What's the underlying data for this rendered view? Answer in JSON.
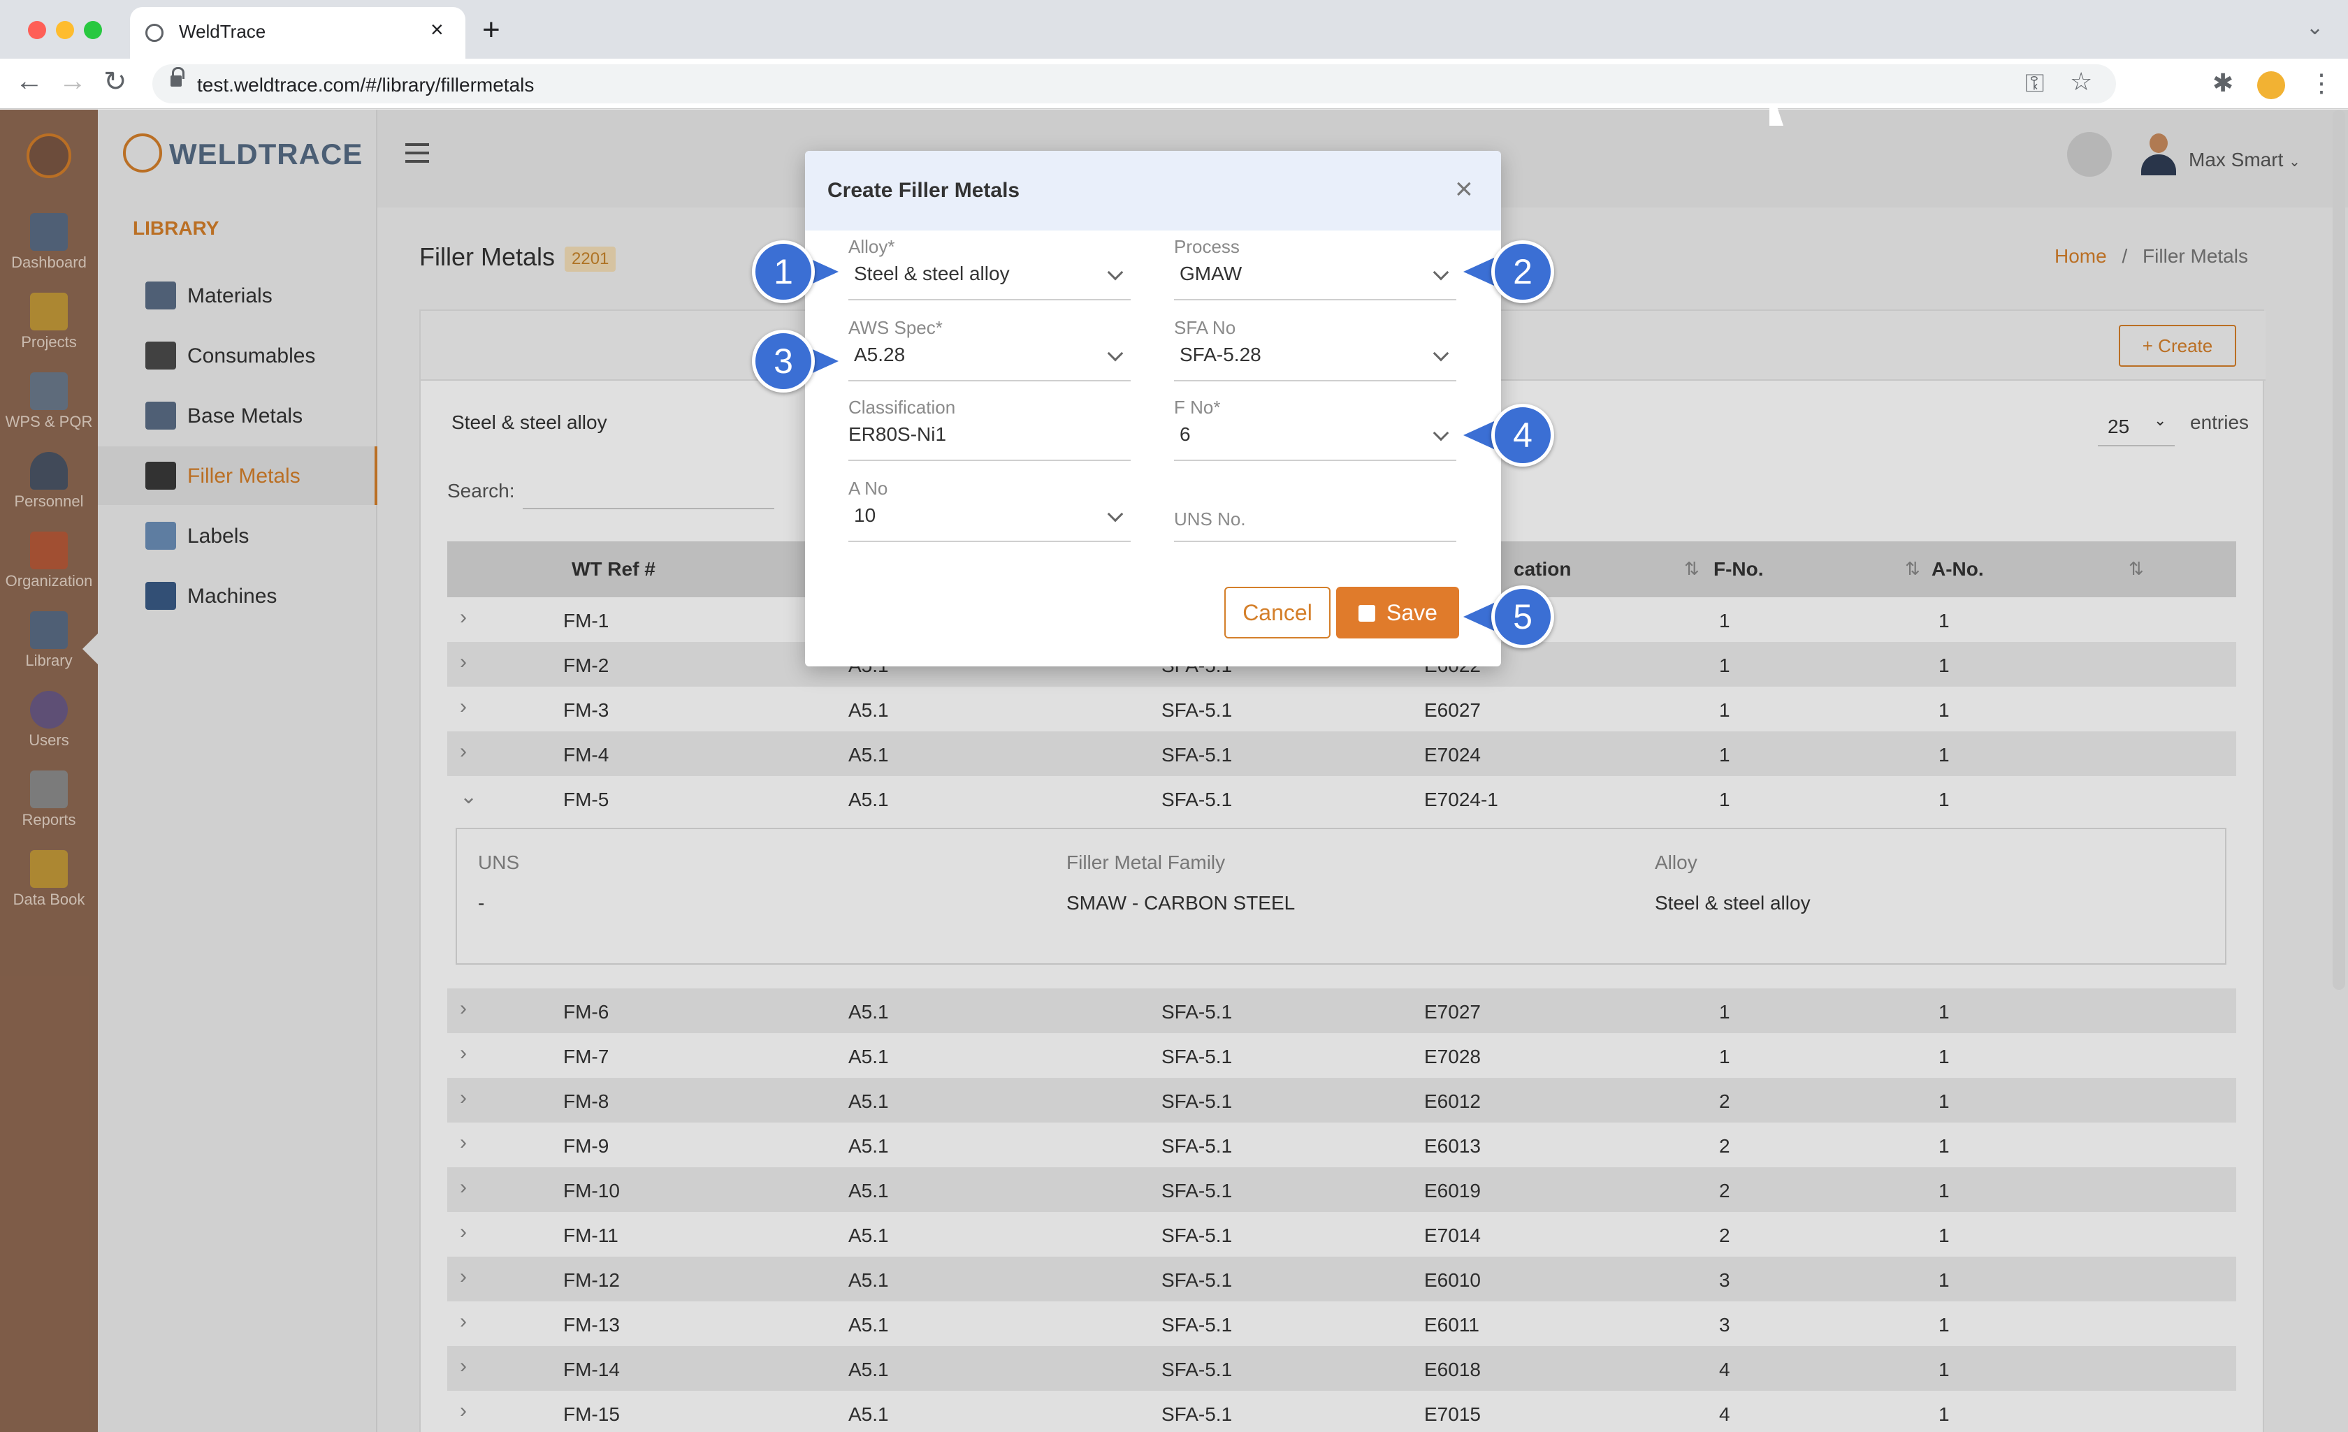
{
  "browser": {
    "tab_title": "WeldTrace",
    "url": "test.weldtrace.com/#/library/fillermetals"
  },
  "app_nav": [
    {
      "label": "Dashboard",
      "icon": "monitor-icon"
    },
    {
      "label": "Projects",
      "icon": "folder-icon"
    },
    {
      "label": "WPS & PQR",
      "icon": "document-gear-icon"
    },
    {
      "label": "Personnel",
      "icon": "welder-icon"
    },
    {
      "label": "Organization",
      "icon": "organization-icon"
    },
    {
      "label": "Library",
      "icon": "library-icon"
    },
    {
      "label": "Users",
      "icon": "users-icon"
    },
    {
      "label": "Reports",
      "icon": "report-icon"
    },
    {
      "label": "Data Book",
      "icon": "data-book-icon"
    }
  ],
  "logo_text": "WELDTRACE",
  "sidebar": {
    "heading": "LIBRARY",
    "items": [
      {
        "label": "Materials",
        "icon": "materials-icon"
      },
      {
        "label": "Consumables",
        "icon": "consumables-icon"
      },
      {
        "label": "Base Metals",
        "icon": "base-metals-icon"
      },
      {
        "label": "Filler Metals",
        "icon": "filler-metals-icon"
      },
      {
        "label": "Labels",
        "icon": "labels-icon"
      },
      {
        "label": "Machines",
        "icon": "machines-icon"
      }
    ]
  },
  "header": {
    "user_name": "Max Smart"
  },
  "page": {
    "title": "Filler Metals",
    "count": "2201",
    "breadcrumb_home": "Home",
    "breadcrumb_sep": "/",
    "breadcrumb_current": "Filler Metals"
  },
  "toolbar": {
    "create_label": "+ Create",
    "alloy_filter": "Steel & steel alloy",
    "entries_value": "25",
    "entries_label": "entries",
    "search_label": "Search:"
  },
  "table": {
    "headers": [
      "WT Ref #",
      "cation",
      "F-No.",
      "A-No."
    ],
    "rows": [
      {
        "ref": "FM-1",
        "aws": "",
        "sfa": "",
        "cls": "",
        "fno": "1",
        "ano": "1"
      },
      {
        "ref": "FM-2",
        "aws": "A5.1",
        "sfa": "SFA-5.1",
        "cls": "E6022",
        "fno": "1",
        "ano": "1"
      },
      {
        "ref": "FM-3",
        "aws": "A5.1",
        "sfa": "SFA-5.1",
        "cls": "E6027",
        "fno": "1",
        "ano": "1"
      },
      {
        "ref": "FM-4",
        "aws": "A5.1",
        "sfa": "SFA-5.1",
        "cls": "E7024",
        "fno": "1",
        "ano": "1"
      },
      {
        "ref": "FM-5",
        "aws": "A5.1",
        "sfa": "SFA-5.1",
        "cls": "E7024-1",
        "fno": "1",
        "ano": "1"
      },
      {
        "ref": "FM-6",
        "aws": "A5.1",
        "sfa": "SFA-5.1",
        "cls": "E7027",
        "fno": "1",
        "ano": "1"
      },
      {
        "ref": "FM-7",
        "aws": "A5.1",
        "sfa": "SFA-5.1",
        "cls": "E7028",
        "fno": "1",
        "ano": "1"
      },
      {
        "ref": "FM-8",
        "aws": "A5.1",
        "sfa": "SFA-5.1",
        "cls": "E6012",
        "fno": "2",
        "ano": "1"
      },
      {
        "ref": "FM-9",
        "aws": "A5.1",
        "sfa": "SFA-5.1",
        "cls": "E6013",
        "fno": "2",
        "ano": "1"
      },
      {
        "ref": "FM-10",
        "aws": "A5.1",
        "sfa": "SFA-5.1",
        "cls": "E6019",
        "fno": "2",
        "ano": "1"
      },
      {
        "ref": "FM-11",
        "aws": "A5.1",
        "sfa": "SFA-5.1",
        "cls": "E7014",
        "fno": "2",
        "ano": "1"
      },
      {
        "ref": "FM-12",
        "aws": "A5.1",
        "sfa": "SFA-5.1",
        "cls": "E6010",
        "fno": "3",
        "ano": "1"
      },
      {
        "ref": "FM-13",
        "aws": "A5.1",
        "sfa": "SFA-5.1",
        "cls": "E6011",
        "fno": "3",
        "ano": "1"
      },
      {
        "ref": "FM-14",
        "aws": "A5.1",
        "sfa": "SFA-5.1",
        "cls": "E6018",
        "fno": "4",
        "ano": "1"
      },
      {
        "ref": "FM-15",
        "aws": "A5.1",
        "sfa": "SFA-5.1",
        "cls": "E7015",
        "fno": "4",
        "ano": "1"
      }
    ],
    "detail": {
      "uns_label": "UNS",
      "uns_value": "-",
      "family_label": "Filler Metal Family",
      "family_value": "SMAW - CARBON STEEL",
      "alloy_label": "Alloy",
      "alloy_value": "Steel & steel alloy"
    }
  },
  "modal": {
    "title": "Create Filler Metals",
    "close": "×",
    "fields": {
      "alloy": {
        "label": "Alloy*",
        "value": "Steel & steel alloy"
      },
      "process": {
        "label": "Process",
        "value": "GMAW"
      },
      "aws_spec": {
        "label": "AWS Spec*",
        "value": "A5.28"
      },
      "sfa_no": {
        "label": "SFA No",
        "value": "SFA-5.28"
      },
      "classification": {
        "label": "Classification",
        "value": "ER80S-Ni1"
      },
      "f_no": {
        "label": "F No*",
        "value": "6"
      },
      "a_no": {
        "label": "A No",
        "value": "10"
      },
      "uns_no": {
        "label": "UNS No.",
        "value": ""
      }
    },
    "cancel_label": "Cancel",
    "save_label": "Save"
  },
  "callouts": [
    "1",
    "2",
    "3",
    "4",
    "5"
  ],
  "colors": {
    "accent": "#d47f2a",
    "callout": "#3b6fd4",
    "leftbar": "#8f6952"
  }
}
